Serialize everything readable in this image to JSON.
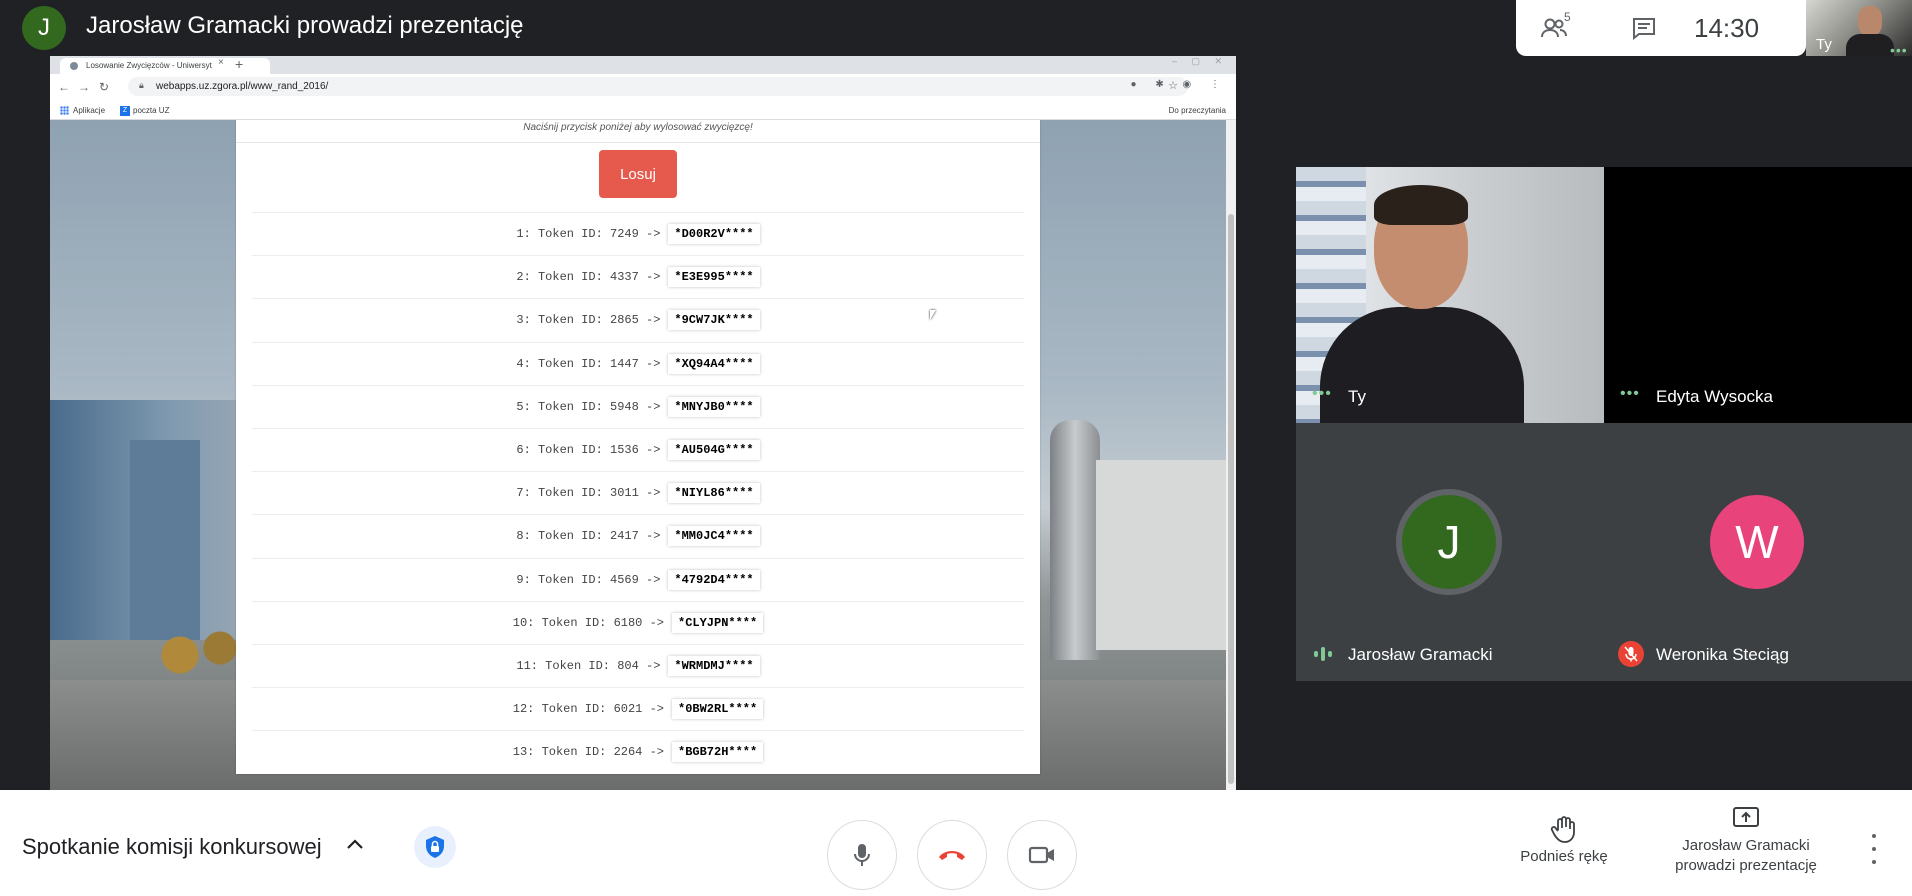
{
  "topbar": {
    "presenter_initial": "J",
    "title": "Jarosław Gramacki prowadzi prezentację",
    "participants_count": "5",
    "clock": "14:30",
    "self_label": "Ty"
  },
  "browser": {
    "tab_title": "Losowanie Zwycięzców - Uniwersyt",
    "url": "webapps.uz.zgora.pl/www_rand_2016/",
    "bookmarks": [
      "Aplikacje",
      "poczta UZ"
    ],
    "reading_list": "Do przeczytania"
  },
  "page": {
    "instruction": "Naciśnij przycisk poniżej aby wylosować zwycięzcę!",
    "draw_button": "Losuj",
    "results": [
      {
        "label": "1: Token ID: 7249 ->",
        "token": "*D00R2V****"
      },
      {
        "label": "2: Token ID: 4337 ->",
        "token": "*E3E995****"
      },
      {
        "label": "3: Token ID: 2865 ->",
        "token": "*9CW7JK****"
      },
      {
        "label": "4: Token ID: 1447 ->",
        "token": "*XQ94A4****"
      },
      {
        "label": "5: Token ID: 5948 ->",
        "token": "*MNYJB0****"
      },
      {
        "label": "6: Token ID: 1536 ->",
        "token": "*AU504G****"
      },
      {
        "label": "7: Token ID: 3011 ->",
        "token": "*NIYL86****"
      },
      {
        "label": "8: Token ID: 2417 ->",
        "token": "*MM0JC4****"
      },
      {
        "label": "9: Token ID: 4569 ->",
        "token": "*4792D4****"
      },
      {
        "label": "10: Token ID: 6180 ->",
        "token": "*CLYJPN****"
      },
      {
        "label": "11: Token ID: 804 ->",
        "token": "*WRMDMJ****"
      },
      {
        "label": "12: Token ID: 6021 ->",
        "token": "*0BW2RL****"
      },
      {
        "label": "13: Token ID: 2264 ->",
        "token": "*BGB72H****"
      }
    ]
  },
  "participants": {
    "self": "Ty",
    "edyta": "Edyta Wysocka",
    "jaroslaw": {
      "name": "Jarosław Gramacki",
      "initial": "J"
    },
    "weronika": {
      "name": "Weronika Steciąg",
      "initial": "W"
    }
  },
  "bottombar": {
    "meeting_title": "Spotkanie komisji konkursowej",
    "raise_hand": "Podnieś rękę",
    "presenting_line1": "Jarosław Gramacki",
    "presenting_line2": "prowadzi prezentację"
  },
  "colors": {
    "draw_button": "#e65a4d",
    "hangup": "#ea4335",
    "avatar_j": "#33691e",
    "avatar_w": "#e8437a",
    "speaking": "#81c995"
  },
  "icons": [
    "people-icon",
    "chat-icon",
    "lock-shield-icon",
    "mic-icon",
    "hangup-icon",
    "camera-icon",
    "hand-icon",
    "present-icon",
    "more-vert-icon",
    "mic-off-icon",
    "audio-level-icon"
  ]
}
